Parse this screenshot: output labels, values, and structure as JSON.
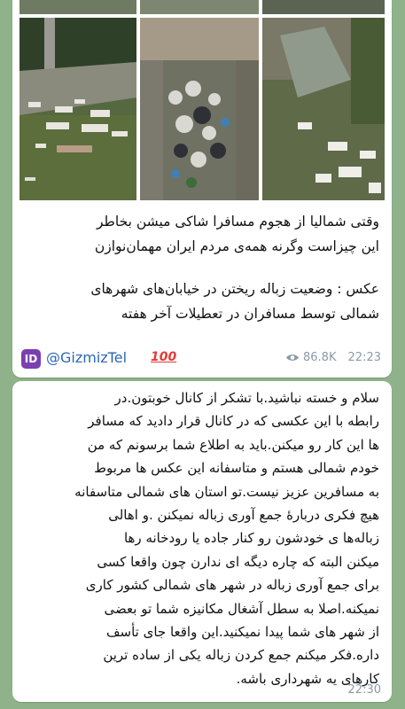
{
  "post": {
    "caption_lines": [
      "وقتی شمالیا از هجوم مسافرا شاکی میشن بخاطر",
      "این چیزاست وگرنه همه‌ی مردم ایران مهمان‌نوازن",
      "عکس : وضعیت زباله ریختن در خیابان‌های شهرهای",
      "شمالی توسط مسافران در تعطیلات آخر هفته"
    ],
    "channel_icon_text": "ID",
    "channel_name": "@GizmizTel",
    "emoji": "100",
    "views": "86.8K",
    "time": "22:23"
  },
  "reply": {
    "lines": [
      "سلام و خسته نباشید.با تشکر از کانال خوبتون.در",
      "رابطه با این عکسی که در کانال قرار دادید که مسافر",
      "ها این کار رو میکنن.باید به اطلاع شما برسونم که من",
      "خودم شمالی هستم و متاسفانه این عکس ها مربوط",
      "به مسافرین عزیز نیست.تو استان های شمالی متاسفانه",
      "هیچ فکری دربارهٔ جمع آوری زباله نمیکنن .و اهالی",
      "زباله‌ها ی خودشون رو کنار جاده یا رودخانه رها",
      "میکنن البته که چاره دیگه ای ندارن چون واقعا کسی",
      "برای جمع آوری زباله در شهر های شمالی کشور کاری",
      "نمیکنه.اصلا به سطل آشغال مکانیزه شما تو بعضی",
      "از شهر های شما پیدا نمیکنید.این واقعا جای تأسف",
      "داره.فکر میکنم جمع کردن زباله یکی از ساده ترین",
      "کارهای یه شهرداری باشه."
    ],
    "time": "22:30"
  },
  "colors": {
    "background": "#8fb28a",
    "bubble": "#ffffff",
    "channel_link": "#2b66b6",
    "meta": "#8a9aa8",
    "channel_icon": "#7a3fb0"
  }
}
